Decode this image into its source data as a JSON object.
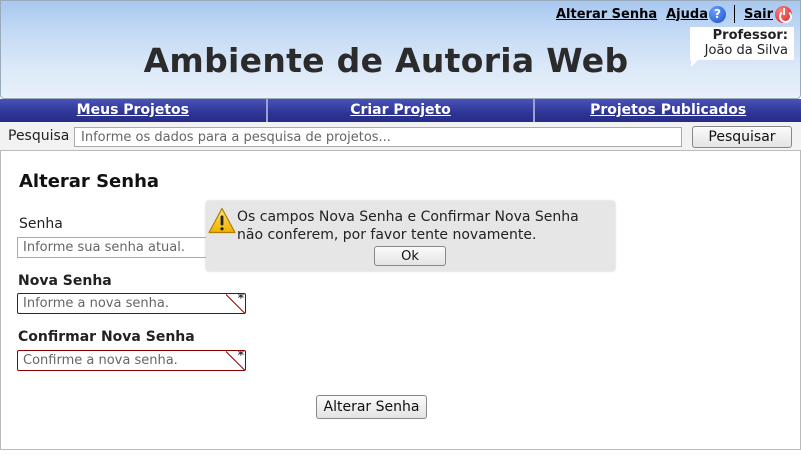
{
  "header": {
    "title": "Ambiente de Autoria Web",
    "links": {
      "change_password": "Alterar Senha",
      "help": "Ajuda",
      "logout": "Sair"
    },
    "user": {
      "role": "Professor:",
      "name": "João da Silva"
    }
  },
  "nav": {
    "items": [
      {
        "label": "Meus Projetos"
      },
      {
        "label": "Criar Projeto"
      },
      {
        "label": "Projetos Publicados"
      }
    ]
  },
  "search": {
    "label": "Pesquisa",
    "placeholder": "Informe os dados para a pesquisa de projetos...",
    "button": "Pesquisar"
  },
  "form": {
    "title": "Alterar Senha",
    "current": {
      "label": "Senha",
      "placeholder": "Informe sua senha atual."
    },
    "new": {
      "label": "Nova Senha",
      "placeholder": "Informe a nova senha."
    },
    "confirm": {
      "label": "Confirmar Nova Senha",
      "placeholder": "Confirme a nova senha."
    },
    "submit": "Alterar Senha"
  },
  "alert": {
    "icon": "warning-icon",
    "message": "Os campos Nova Senha e Confirmar Nova Senha não conferem, por favor tente novamente.",
    "ok": "Ok"
  },
  "colors": {
    "nav_background": "#2c3390",
    "error_border": "#8b0000",
    "header_gradient_top": "#a8c8f0"
  }
}
